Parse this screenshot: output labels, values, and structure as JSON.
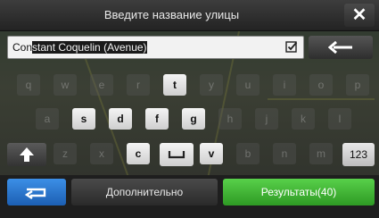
{
  "header": {
    "title": "Введите название улицы",
    "close_icon": "close-icon",
    "close_glyph": "✕"
  },
  "input": {
    "typed": "Con",
    "suggestion": "stant Coquelin (Avenue)",
    "check_icon": "checkbox-check-icon"
  },
  "backspace": {
    "icon": "backspace-arrow-icon"
  },
  "keyboard": {
    "row1": [
      {
        "label": "q",
        "enabled": false
      },
      {
        "label": "w",
        "enabled": false
      },
      {
        "label": "e",
        "enabled": false
      },
      {
        "label": "r",
        "enabled": false
      },
      {
        "label": "t",
        "enabled": true
      },
      {
        "label": "y",
        "enabled": false
      },
      {
        "label": "u",
        "enabled": false
      },
      {
        "label": "i",
        "enabled": false
      },
      {
        "label": "o",
        "enabled": false
      },
      {
        "label": "p",
        "enabled": false
      }
    ],
    "row2": [
      {
        "label": "a",
        "enabled": false
      },
      {
        "label": "s",
        "enabled": true
      },
      {
        "label": "d",
        "enabled": true
      },
      {
        "label": "f",
        "enabled": true
      },
      {
        "label": "g",
        "enabled": true
      },
      {
        "label": "h",
        "enabled": false
      },
      {
        "label": "j",
        "enabled": false
      },
      {
        "label": "k",
        "enabled": false
      },
      {
        "label": "l",
        "enabled": false
      }
    ],
    "row3": [
      {
        "label": "z",
        "enabled": false
      },
      {
        "label": "x",
        "enabled": false
      },
      {
        "label": "c",
        "enabled": true
      },
      {
        "label": "space",
        "enabled": true
      },
      {
        "label": "v",
        "enabled": true
      },
      {
        "label": "b",
        "enabled": false
      },
      {
        "label": "n",
        "enabled": false
      },
      {
        "label": "m",
        "enabled": false
      }
    ],
    "shift_icon": "shift-arrow-icon",
    "numbers_label": "123"
  },
  "footer": {
    "back_icon": "return-arrow-icon",
    "more_label": "Дополнительно",
    "results_label": "Результаты(40)"
  },
  "colors": {
    "results_green": "#3fb534",
    "back_blue": "#2a76d2"
  }
}
